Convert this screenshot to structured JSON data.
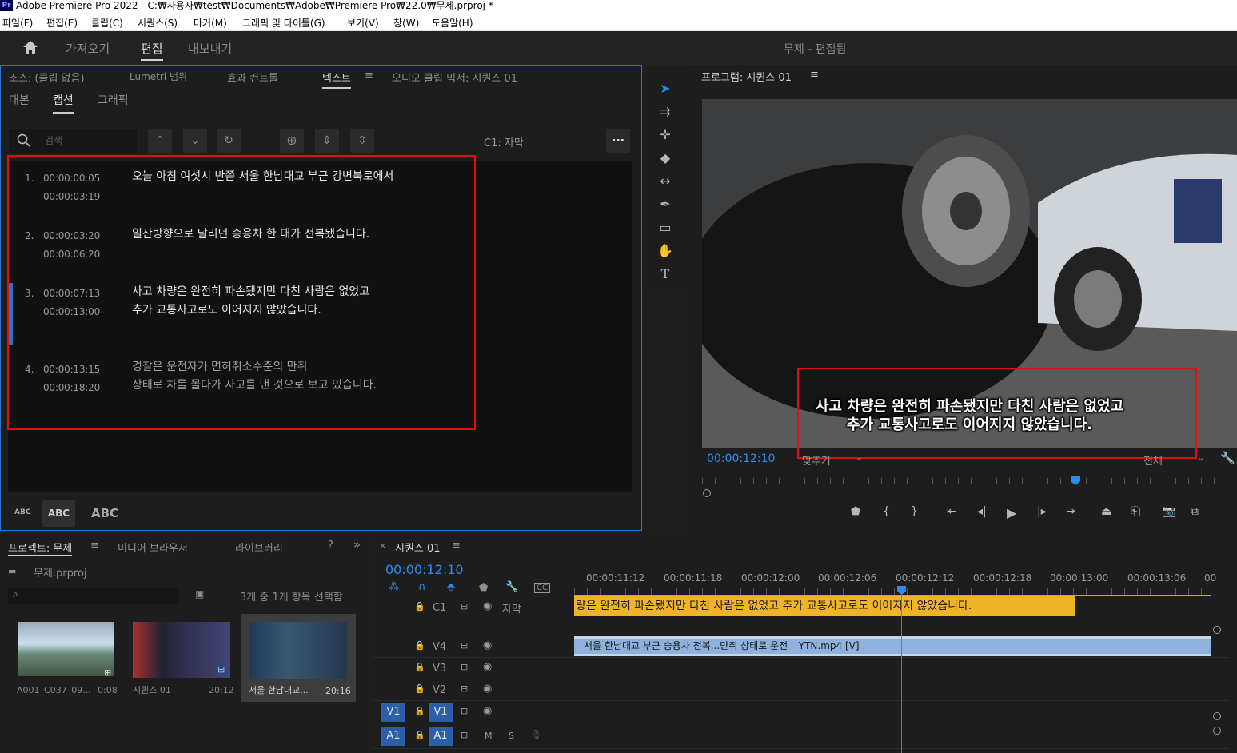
{
  "title_bar": {
    "logo": "Pr",
    "text": "Adobe Premiere Pro 2022 - C:₩사용자₩test₩Documents₩Adobe₩Premiere Pro₩22.0₩무제.prproj *"
  },
  "menu": [
    "파일(F)",
    "편집(E)",
    "클립(C)",
    "시퀀스(S)",
    "마커(M)",
    "그래픽 및 타이틀(G)",
    "보기(V)",
    "창(W)",
    "도움말(H)"
  ],
  "workspace": {
    "tabs": [
      "가져오기",
      "편집",
      "내보내기"
    ],
    "active": "편집",
    "project_status": "무제 - 편집됨"
  },
  "source_panel": {
    "tabs": [
      "소스: (클립 없음)",
      "Lumetri 범위",
      "효과 컨트롤",
      "텍스트",
      "오디오 클립 믹서: 시퀀스 01"
    ],
    "active_tab": "텍스트",
    "subtabs": [
      "대본",
      "캡션",
      "그래픽"
    ],
    "active_subtab": "캡션",
    "search_placeholder": "검색",
    "track_label": "C1: 자막",
    "captions": [
      {
        "index": "1.",
        "in": "00:00:00:05",
        "out": "00:00:03:19",
        "text": "오늘 아침 여섯시 반쯤 서울 한남대교 부근 강변북로에서",
        "dim": false
      },
      {
        "index": "2.",
        "in": "00:00:03:20",
        "out": "00:00:06:20",
        "text": "일산방향으로 달리던 승용차 한 대가 전복됐습니다.",
        "dim": false
      },
      {
        "index": "3.",
        "in": "00:00:07:13",
        "out": "00:00:13:00",
        "text": "사고 차량은 완전히 파손됐지만 다친 사람은 없었고\n추가 교통사고로도 이어지지 않았습니다.",
        "dim": false
      },
      {
        "index": "4.",
        "in": "00:00:13:15",
        "out": "00:00:18:20",
        "text": "경찰은 운전자가 면허취소수준의 만취\n상태로 차를 몰다가 사고를 낸 것으로 보고 있습니다.",
        "dim": true
      }
    ],
    "text_size_labels": [
      "ABC",
      "ABC",
      "ABC"
    ]
  },
  "program_panel": {
    "title": "프로그램: 시퀀스 01",
    "subtitle": "사고 차량은 완전히 파손됐지만 다친 사람은 없었고\n추가 교통사고로도 이어지지 않았습니다.",
    "timecode": "00:00:12:10",
    "fit": "맞추기",
    "quality": "전체"
  },
  "project_panel": {
    "tabs": [
      "프로젝트: 무제",
      "미디어 브라우저",
      "라이브러리"
    ],
    "project_file": "무제.prproj",
    "selection_info": "3개 중 1개 항목 선택함",
    "items": [
      {
        "name": "A001_C037_09...",
        "duration": "0:08"
      },
      {
        "name": "시퀀스 01",
        "duration": "20:12"
      },
      {
        "name": "서울 한남대교...",
        "duration": "20:16"
      }
    ]
  },
  "timeline": {
    "tab": "시퀀스 01",
    "timecode": "00:00:12:10",
    "ruler": [
      "00:00:11:12",
      "00:00:11:18",
      "00:00:12:00",
      "00:00:12:06",
      "00:00:12:12",
      "00:00:12:18",
      "00:00:13:00",
      "00:00:13:06",
      "00"
    ],
    "tracks": [
      {
        "id": "C1",
        "name": "자막"
      },
      {
        "id": "V4"
      },
      {
        "id": "V3"
      },
      {
        "id": "V2"
      },
      {
        "id": "V1",
        "src": "V1"
      },
      {
        "id": "A1",
        "src": "A1",
        "m": "M",
        "s": "S"
      }
    ],
    "caption_clip": "량은 완전히 파손됐지만 다친 사람은 없었고 추가 교통사고로도 이어지지 않았습니다.",
    "video_clip": "서울 한남대교 부근 승용차 전복...만취 상태로 운전 _ YTN.mp4 [V]"
  },
  "colors": {
    "accent_blue": "#2d8ceb",
    "caption_clip": "#f0b429",
    "video_clip": "#8fb1dd",
    "highlight_red": "#e01010"
  }
}
